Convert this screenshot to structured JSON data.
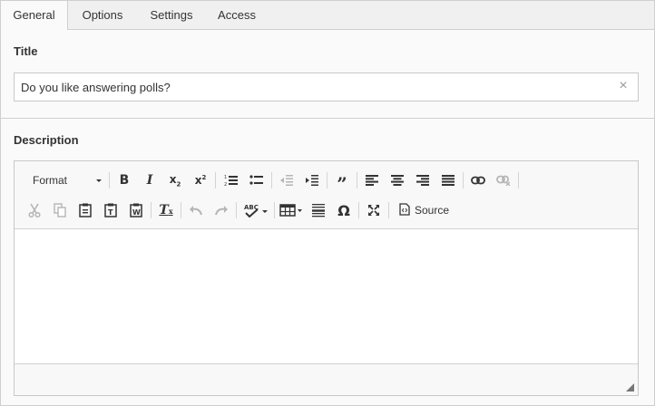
{
  "tabs": [
    {
      "label": "General",
      "active": true
    },
    {
      "label": "Options",
      "active": false
    },
    {
      "label": "Settings",
      "active": false
    },
    {
      "label": "Access",
      "active": false
    }
  ],
  "title_field": {
    "label": "Title",
    "value": "Do you like answering polls?",
    "clear_icon": "close-icon"
  },
  "description_field": {
    "label": "Description",
    "toolbar": {
      "format_label": "Format",
      "source_label": "Source",
      "row1_icons": [
        "bold-icon",
        "italic-icon",
        "subscript-icon",
        "superscript-icon",
        "numbered-list-icon",
        "bulleted-list-icon",
        "outdent-icon",
        "indent-icon",
        "blockquote-icon",
        "align-left-icon",
        "align-center-icon",
        "align-right-icon",
        "justify-icon",
        "link-icon",
        "unlink-icon"
      ],
      "row2_icons": [
        "cut-icon",
        "copy-icon",
        "paste-icon",
        "paste-text-icon",
        "paste-word-icon",
        "remove-format-icon",
        "undo-icon",
        "redo-icon",
        "spellcheck-icon",
        "table-icon",
        "horizontal-line-icon",
        "special-char-icon",
        "maximize-icon",
        "source-icon"
      ]
    },
    "content": ""
  },
  "colors": {
    "panel_bg": "#fafafa",
    "border": "#cfcfcf",
    "toolbar_bg": "#f8f8f8",
    "icon": "#333333",
    "icon_disabled": "#b5b5b5"
  }
}
